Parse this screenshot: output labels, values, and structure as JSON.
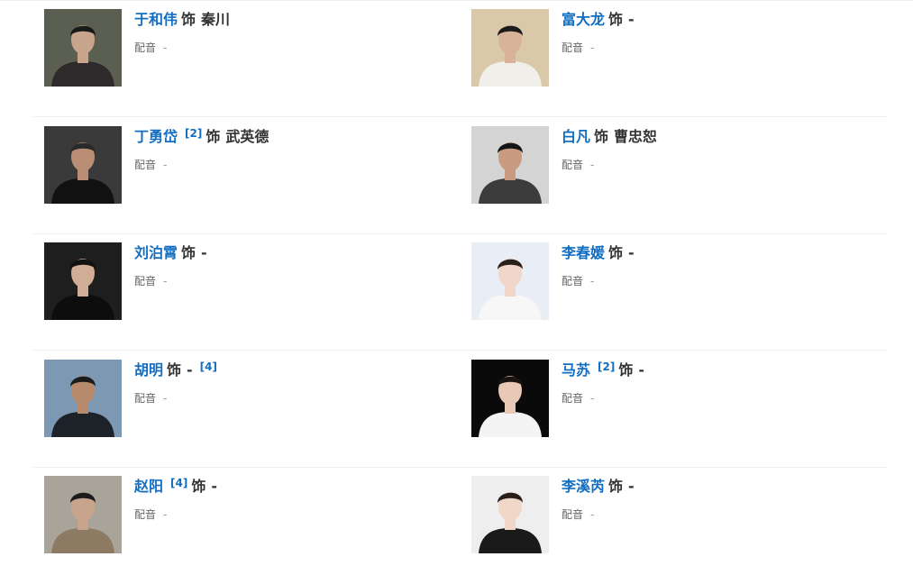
{
  "cast": [
    {
      "actor": "于和伟",
      "ref_before": "",
      "sep": "饰",
      "role": "秦川",
      "ref_after": "",
      "dub_label": "配音",
      "dub_value": "-",
      "photo": {
        "bg": "#5b5f52",
        "suit": "#2e2a2c",
        "skin": "#c9a48d",
        "hair": "#1a1a1a"
      }
    },
    {
      "actor": "富大龙",
      "ref_before": "",
      "sep": "饰",
      "role": "-",
      "ref_after": "",
      "dub_label": "配音",
      "dub_value": "-",
      "photo": {
        "bg": "#d9c9a8",
        "suit": "#f0efe9",
        "skin": "#d8b39a",
        "hair": "#1c1c1c"
      }
    },
    {
      "actor": "丁勇岱",
      "ref_before": "[2]",
      "sep": "饰",
      "role": "武英德",
      "ref_after": "",
      "dub_label": "配音",
      "dub_value": "-",
      "photo": {
        "bg": "#3a3a3a",
        "suit": "#111111",
        "skin": "#b98e74",
        "hair": "#2a2a2a"
      }
    },
    {
      "actor": "白凡",
      "ref_before": "",
      "sep": "饰",
      "role": "曹忠恕",
      "ref_after": "",
      "dub_label": "配音",
      "dub_value": "-",
      "photo": {
        "bg": "#d4d4d4",
        "suit": "#3c3c3c",
        "skin": "#c89a80",
        "hair": "#151515"
      }
    },
    {
      "actor": "刘泊霄",
      "ref_before": "",
      "sep": "饰",
      "role": "-",
      "ref_after": "",
      "dub_label": "配音",
      "dub_value": "-",
      "photo": {
        "bg": "#1e1e1e",
        "suit": "#0d0d0d",
        "skin": "#d2ad96",
        "hair": "#111111"
      }
    },
    {
      "actor": "李春媛",
      "ref_before": "",
      "sep": "饰",
      "role": "-",
      "ref_after": "",
      "dub_label": "配音",
      "dub_value": "-",
      "photo": {
        "bg": "#e9eef6",
        "suit": "#f7f7f7",
        "skin": "#f0d6c8",
        "hair": "#2b1f1c"
      }
    },
    {
      "actor": "胡明",
      "ref_before": "",
      "sep": "饰",
      "role": "-",
      "ref_after": "[4]",
      "dub_label": "配音",
      "dub_value": "-",
      "photo": {
        "bg": "#7c98b3",
        "suit": "#1d2229",
        "skin": "#b78a6e",
        "hair": "#1b1b1b"
      }
    },
    {
      "actor": "马苏",
      "ref_before": "[2]",
      "sep": "饰",
      "role": "-",
      "ref_after": "",
      "dub_label": "配音",
      "dub_value": "-",
      "photo": {
        "bg": "#0a0a0a",
        "suit": "#f4f4f4",
        "skin": "#e8c8b6",
        "hair": "#1a1411"
      }
    },
    {
      "actor": "赵阳",
      "ref_before": "[4]",
      "sep": "饰",
      "role": "-",
      "ref_after": "",
      "dub_label": "配音",
      "dub_value": "-",
      "photo": {
        "bg": "#a9a49a",
        "suit": "#8c7a62",
        "skin": "#c9a48c",
        "hair": "#1c1c1c"
      }
    },
    {
      "actor": "李溪芮",
      "ref_before": "",
      "sep": "饰",
      "role": "-",
      "ref_after": "",
      "dub_label": "配音",
      "dub_value": "-",
      "photo": {
        "bg": "#eeeeee",
        "suit": "#1a1a1a",
        "skin": "#f1d7c8",
        "hair": "#2a1d18"
      }
    }
  ],
  "colors": {
    "actor_link": "#136ec2",
    "text": "#333333",
    "muted": "#666666",
    "divider": "#ececec"
  }
}
